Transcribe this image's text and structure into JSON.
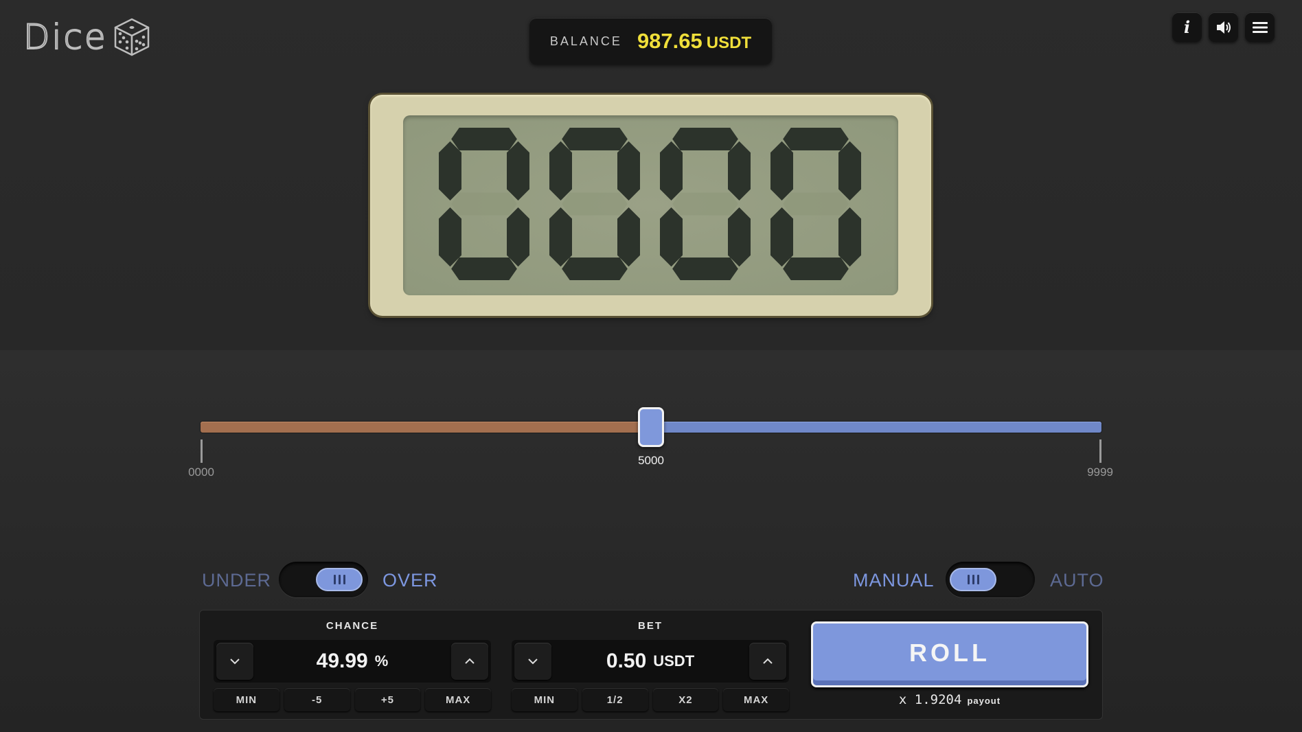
{
  "app": {
    "logo_text": "Dice"
  },
  "balance": {
    "label": "BALANCE",
    "value": "987.65",
    "unit": "USDT"
  },
  "toolbar": {
    "info_label": "i"
  },
  "display": {
    "digits": [
      "0",
      "0",
      "0",
      "0"
    ]
  },
  "slider": {
    "min_label": "0000",
    "max_label": "9999",
    "value_label": "5000",
    "value": 5000,
    "min": 0,
    "max": 9999
  },
  "direction": {
    "left_label": "UNDER",
    "right_label": "OVER",
    "selected": "OVER"
  },
  "mode": {
    "left_label": "MANUAL",
    "right_label": "AUTO",
    "selected": "MANUAL"
  },
  "chance": {
    "title": "CHANCE",
    "value": "49.99",
    "unit": "%",
    "buttons": [
      "MIN",
      "-5",
      "+5",
      "MAX"
    ]
  },
  "bet": {
    "title": "BET",
    "value": "0.50",
    "unit": "USDT",
    "buttons": [
      "MIN",
      "1/2",
      "X2",
      "MAX"
    ]
  },
  "roll": {
    "label": "ROLL",
    "payout_value": "x 1.9204",
    "payout_word": "payout"
  },
  "colors": {
    "accent": "#7e97dc",
    "under_track": "#a36f4f",
    "balance": "#f0df3a",
    "lcd": "#9aa186"
  }
}
